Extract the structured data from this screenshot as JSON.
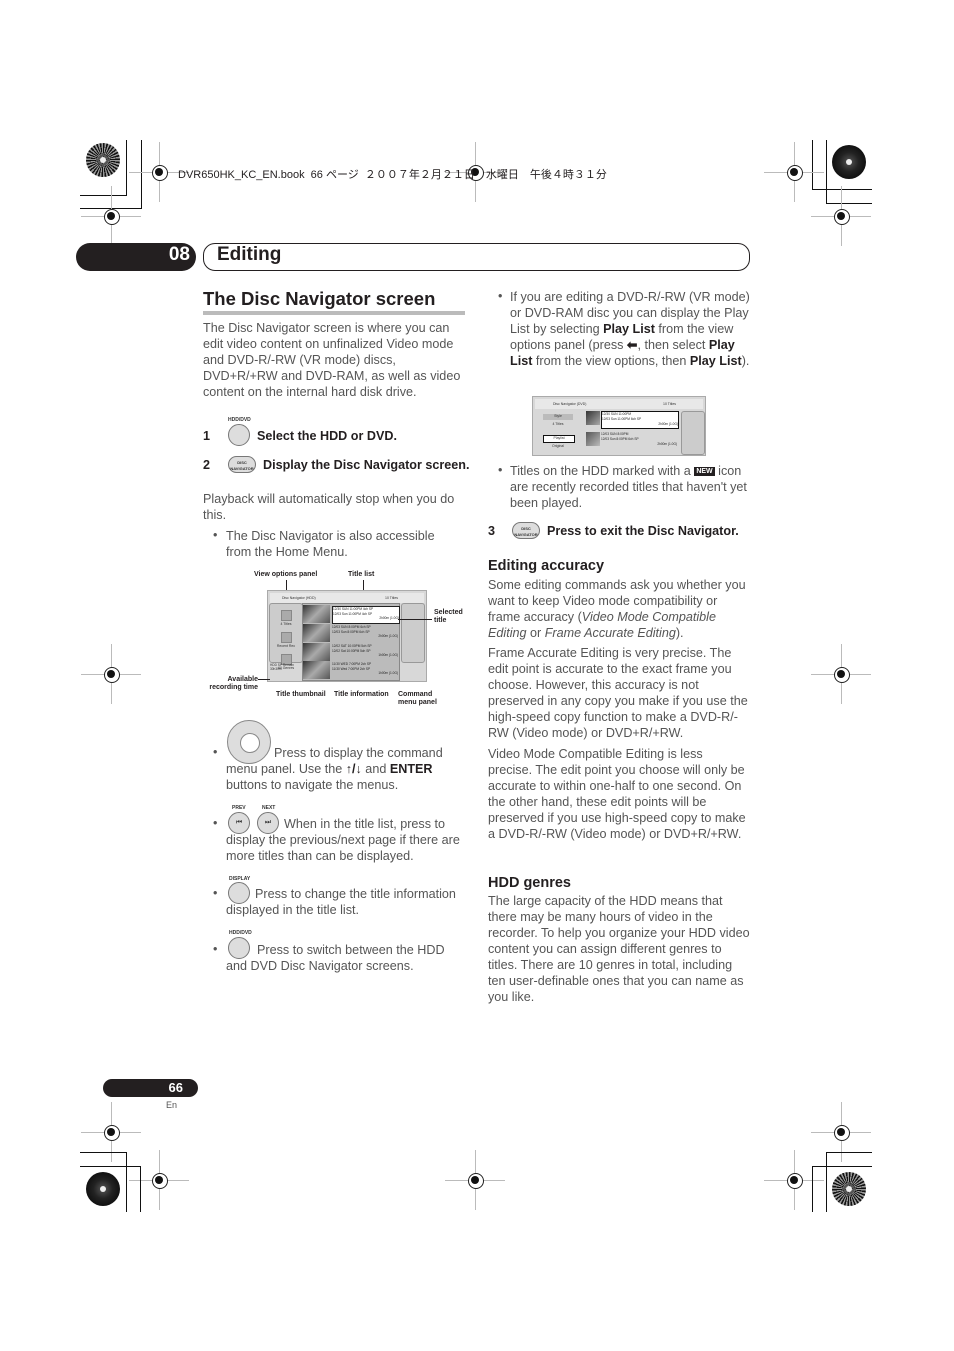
{
  "print_header": "DVR650HK_KC_EN.book  66 ページ  ２００７年２月２１日　水曜日　午後４時３１分",
  "chapter": {
    "number": "08",
    "title": "Editing"
  },
  "section": {
    "title": "The Disc Navigator screen",
    "intro": "The Disc Navigator screen is where you can edit video content on unfinalized Video mode and DVD-R/-RW (VR mode) discs, DVD+R/+RW and DVD-RAM, as well as video content on the internal hard disk drive."
  },
  "steps": [
    {
      "number": "1",
      "button_label": "HDD/DVD",
      "text": "Select the HDD or DVD."
    },
    {
      "number": "2",
      "button_label": "DISC NAVIGATOR",
      "text": "Display the Disc Navigator screen.",
      "note": "Playback will automatically stop when you do this.",
      "bullet": "The Disc Navigator is also accessible from the Home Menu."
    },
    {
      "number": "3",
      "button_label": "DISC NAVIGATOR",
      "text": "Press to exit the Disc Navigator."
    }
  ],
  "diagram": {
    "callouts": {
      "view_options": "View options panel",
      "title_list": "Title list",
      "selected_title": "Selected title",
      "available_time": "Available recording time",
      "thumbnail": "Title thumbnail",
      "title_info": "Title information",
      "command_menu": "Command menu panel"
    },
    "screen": {
      "header": "Disc Navigator (HDD)",
      "count": "10 Titles",
      "view_options": [
        "4 Titles",
        "Recent Rec",
        "All Genres"
      ],
      "available": "HDD SP Remain 30h30m",
      "rows": [
        {
          "line1": "12/30 SUN  11:00PM 4ch SP",
          "line2": "12/03 Sun  11:00PM 4ch SP",
          "line3": "2h00m (1.0G)",
          "selected": true
        },
        {
          "line1": "12/03 SUN  8:00PM 6ch  SP",
          "line2": "12/03  Sun  8:00PM 6ch  SP",
          "line3": "2h00m (1.0G)",
          "selected": false
        },
        {
          "line1": "12/02 SAT 10:00PM 5ch  SP",
          "line2": "12/02 Sat  10:00PM 5ch  SP",
          "line3": "1h00m (1.0G)",
          "selected": false
        },
        {
          "line1": "11/30 WED 7:00PM 2ch  SP",
          "line2": "11/30 Wed  7:00PM 2ch  SP",
          "line3": "1h00m (1.0G)",
          "selected": false
        }
      ]
    }
  },
  "left_bullets": [
    {
      "text_before": "Press to display the command menu panel. Use the ",
      "arrows": "↑/↓",
      "mid": " and ",
      "bold": "ENTER",
      "after": " buttons to navigate the menus."
    },
    {
      "labels": [
        "PREV",
        "NEXT"
      ],
      "text": "When in the title list, press to display the previous/next page if there are more titles than can be displayed."
    },
    {
      "label": "DISPLAY",
      "text": "Press to change the title information displayed in the title list."
    },
    {
      "label": "HDD/DVD",
      "text": "Press to switch between the HDD and DVD Disc Navigator screens."
    }
  ],
  "right_bullets": {
    "playlist": {
      "t1": "If you are editing a DVD-R/-RW (VR mode) or DVD-RAM disc you can display the Play List by selecting ",
      "b1": "Play List",
      "t2": " from the view options panel (press ",
      "arrow": "⬅",
      "t3": ", then select ",
      "b2": "Play List",
      "t4": " from the view options, then ",
      "b3": "Play List",
      "t5": ")."
    },
    "new_icon": {
      "t1": "Titles on the HDD marked with a ",
      "badge": "NEW",
      "t2": " icon are recently recorded titles that haven't yet been played."
    }
  },
  "screen2": {
    "header": "Disc Navigator (DVD)",
    "count": "10 Titles",
    "options": [
      "Style",
      "4 Titles",
      "Playlist",
      "Original"
    ],
    "rows": [
      {
        "line1": "12/30 SUN  11:00PM",
        "line2": "12/03 Sun  11:00PM 6ch SP",
        "line3": "2h00m (1.0G)"
      },
      {
        "line1": "12/03 SUN  8:00PM",
        "line2": "12/03  Sun  8:00PM 6ch  SP",
        "line3": "2h00m (1.0G)"
      }
    ]
  },
  "editing_accuracy": {
    "heading": "Editing accuracy",
    "p1_a": "Some editing commands ask you whether you want to keep Video mode compatibility or frame accuracy (",
    "p1_i1": "Video Mode Compatible Editing",
    "p1_b": " or ",
    "p1_i2": "Frame Accurate Editing",
    "p1_c": ").",
    "p2": "Frame Accurate Editing is very precise. The edit point is accurate to the exact frame you choose. However, this accuracy is not preserved in any copy you make if you use the high-speed copy function to make a DVD-R/-RW (Video mode) or DVD+R/+RW.",
    "p3": "Video Mode Compatible Editing is less precise. The edit point you choose will only be accurate to within one-half to one second. On the other hand, these edit points will be preserved if you use high-speed copy to make a DVD-R/-RW (Video mode) or DVD+R/+RW."
  },
  "hdd_genres": {
    "heading": "HDD genres",
    "text": "The large capacity of the HDD means that there may be many hours of video in the recorder. To help you organize your HDD video content you can assign different genres to titles. There are 10 genres in total, including ten user-definable ones that you can name as you like."
  },
  "footer": {
    "page": "66",
    "lang": "En"
  }
}
